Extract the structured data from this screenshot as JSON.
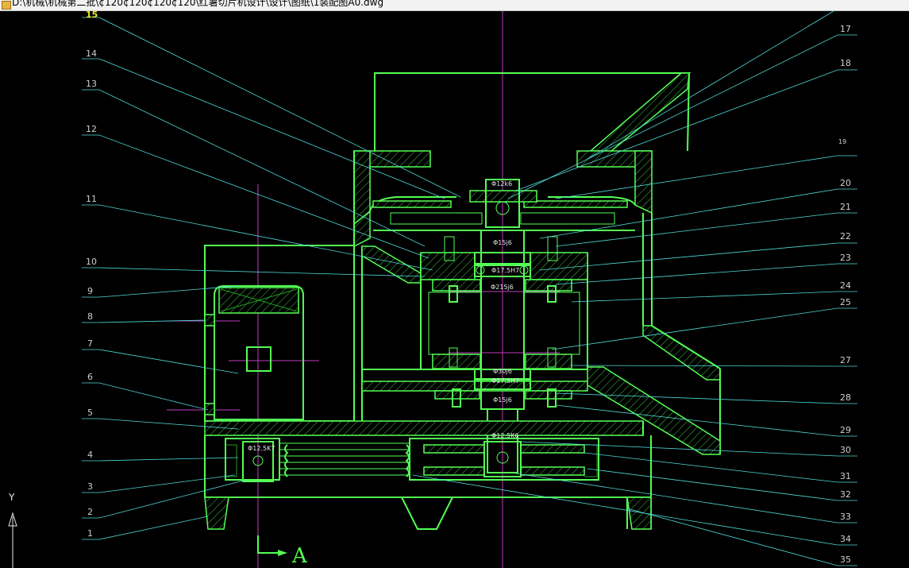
{
  "window": {
    "title": "D:\\机械\\机械第二批\\¢120¢120¢120¢120\\红薯切片机设计\\设计\\图纸\\1装配图A0.dwg"
  },
  "drawing": {
    "part_numbers_left": [
      "15",
      "14",
      "13",
      "12",
      "11",
      "10",
      "9",
      "8",
      "7",
      "6",
      "5",
      "4",
      "3",
      "2",
      "1"
    ],
    "part_numbers_right": [
      "17",
      "18",
      "19",
      "20",
      "21",
      "22",
      "23",
      "24",
      "25",
      "27",
      "28",
      "29",
      "30",
      "31",
      "32",
      "33",
      "34",
      "35"
    ],
    "dimensions": [
      "Φ12k6",
      "Φ15j6",
      "Φ17.5H7",
      "Φ215j6",
      "Φ30j6",
      "Φ17.5H7",
      "Φ15j6",
      "Φ12.5K6",
      "Φ12.5K7"
    ],
    "section_label": "A",
    "ucs_y_label": "Y"
  },
  "colors": {
    "background": "#000000",
    "geometry": "#55ff55",
    "leader": "#4fd8d8",
    "centerline": "#c23cc2",
    "text": "#cfcfcf"
  }
}
